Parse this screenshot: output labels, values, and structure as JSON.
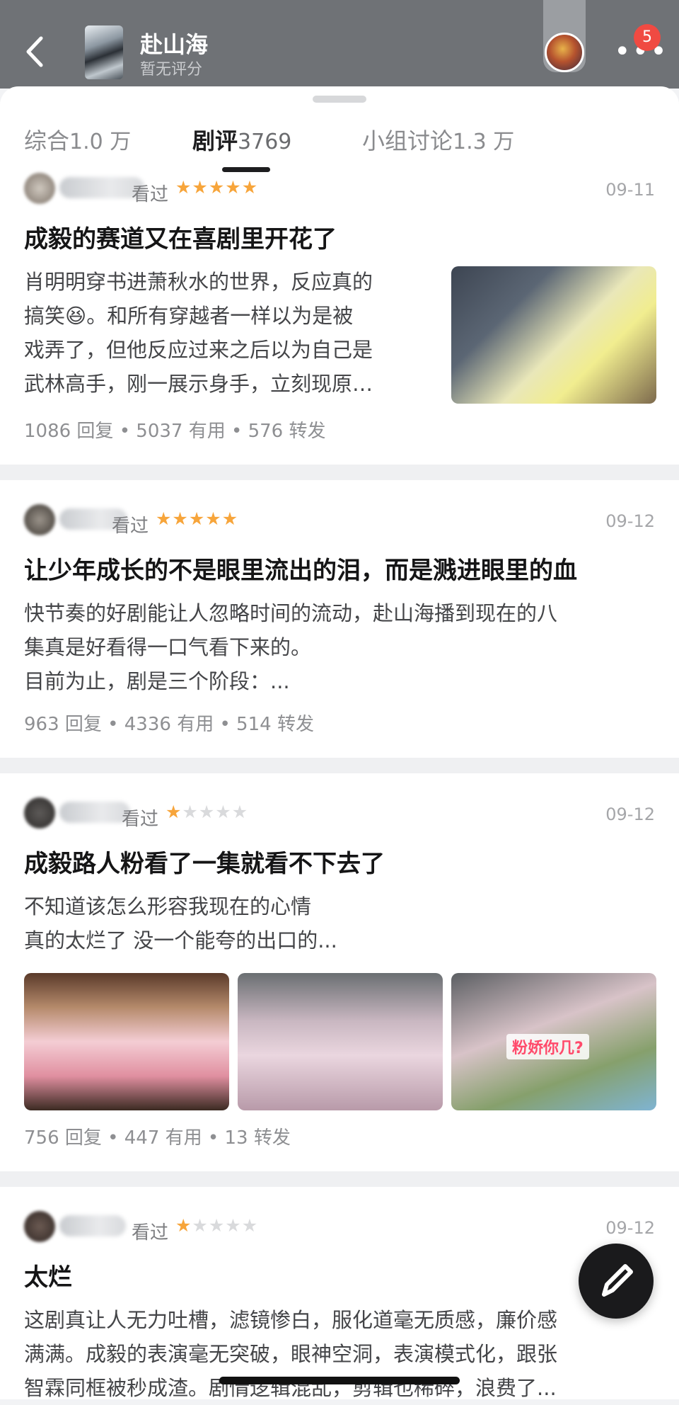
{
  "header": {
    "title": "赴山海",
    "subtitle": "暂无评分",
    "notification_count": "5",
    "more_label": "•••"
  },
  "tabs": [
    {
      "label": "综合",
      "count": "1.0 万"
    },
    {
      "label": "剧评",
      "count": "3769"
    },
    {
      "label": "小组讨论",
      "count": "1.3 万"
    }
  ],
  "reviews": [
    {
      "status": "看过",
      "rating": 5,
      "date": "09-11",
      "title": "成毅的赛道又在喜剧里开花了",
      "body": [
        "肖明明穿书进萧秋水的世界，反应真的",
        "搞笑😆。和所有穿越者一样以为是被",
        "戏弄了，但他反应过来之后以为自己是",
        "武林高手，刚一展示身手，立刻现原…"
      ],
      "stats": "1086 回复 • 5037 有用 • 576 转发"
    },
    {
      "status": "看过",
      "rating": 5,
      "date": "09-12",
      "title": "让少年成长的不是眼里流出的泪，而是溅进眼里的血",
      "body": [
        "快节奏的好剧能让人忽略时间的流动，赴山海播到现在的八",
        "集真是好看得一口气看下来的。",
        "目前为止，剧是三个阶段：..."
      ],
      "stats": "963 回复 • 4336 有用 • 514 转发"
    },
    {
      "status": "看过",
      "rating": 1,
      "date": "09-12",
      "title": "成毅路人粉看了一集就看不下去了",
      "body": [
        "不知道该怎么形容我现在的心情",
        "真的太烂了 没一个能夸的出口的..."
      ],
      "image_caption": "粉娇你几?",
      "stats": "756 回复 • 447 有用 • 13 转发"
    },
    {
      "status": "看过",
      "rating": 1,
      "date": "09-12",
      "title": "太烂",
      "body": [
        "这剧真让人无力吐槽，滤镜惨白，服化道毫无质感，廉价感",
        "满满。成毅的表演毫无突破，眼神空洞，表演模式化，跟张",
        "智霖同框被秒成渣。剧情逻辑混乱，剪辑也稀碎，浪费了..."
      ]
    }
  ],
  "star_glyph": "★",
  "colors": {
    "star": "#f7a53b",
    "star_empty": "#d9dadc",
    "badge": "#f04a42"
  },
  "icons": [
    "back-arrow-icon",
    "more-dots-icon",
    "pencil-icon"
  ]
}
